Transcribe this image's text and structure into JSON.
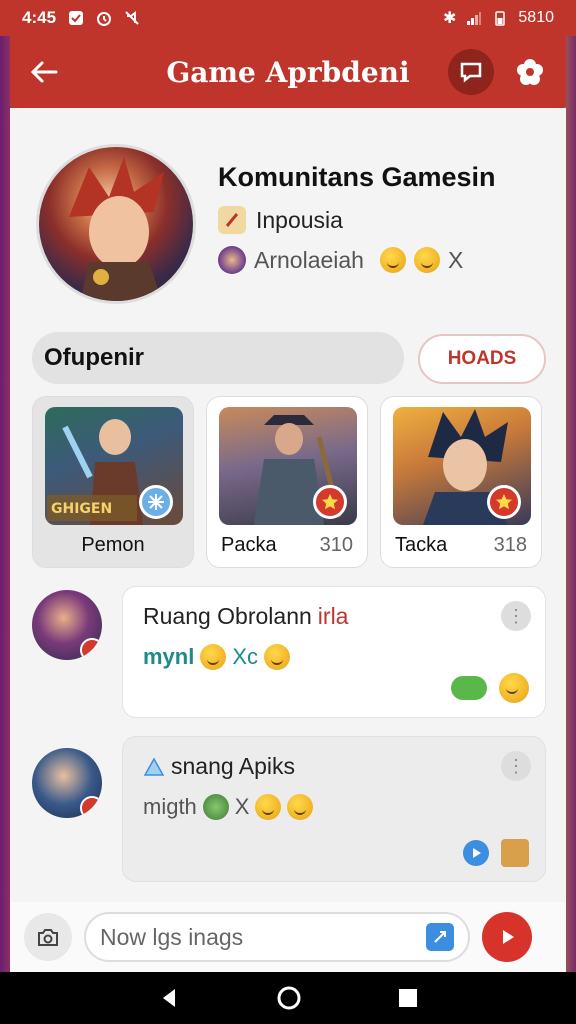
{
  "status_bar": {
    "time": "4:45",
    "battery": "5810"
  },
  "header": {
    "title": "Game Aprbdeni"
  },
  "profile": {
    "name": "Komunitans Gamesin",
    "subtitle": "Inpousia",
    "members": "Arnolaeiah",
    "members_suffix": "X"
  },
  "filter": {
    "search_value": "Ofupenir",
    "action_label": "HOADS"
  },
  "games": [
    {
      "label": "Pemon",
      "count": "",
      "art_text": "GHIGEN"
    },
    {
      "label": "Packa",
      "count": "310"
    },
    {
      "label": "Tacka",
      "count": "318"
    }
  ],
  "messages": [
    {
      "title": "Ruang Obrolann",
      "title_accent": "irla",
      "line": "mynl",
      "line_suffix": "Xc"
    },
    {
      "title": "snang Apiks",
      "line": "migth",
      "line_suffix": "X"
    }
  ],
  "composer": {
    "placeholder": "Now lgs inags"
  },
  "colors": {
    "brand": "#c0352b",
    "send": "#d8332b"
  }
}
